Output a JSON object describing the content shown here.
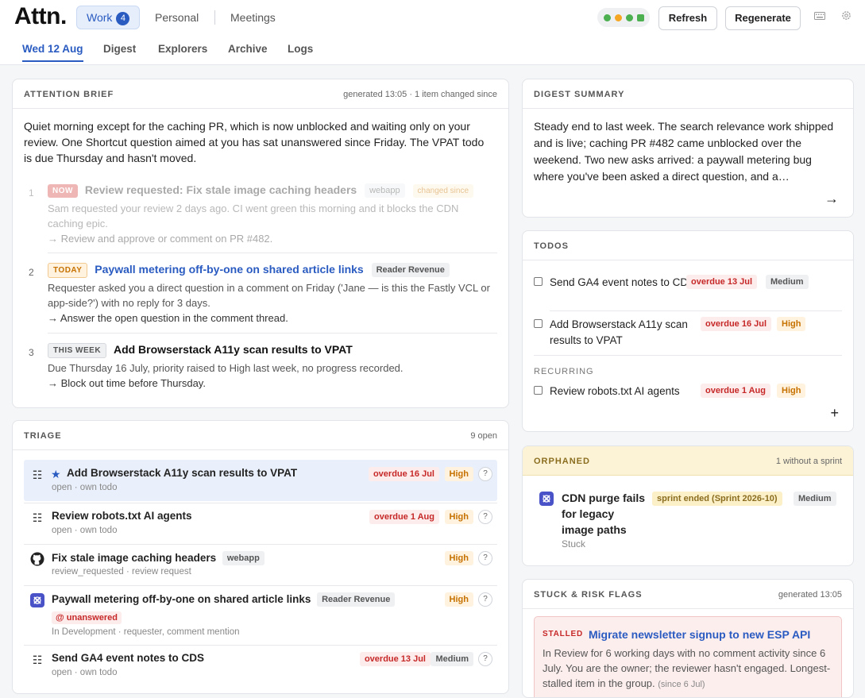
{
  "app": {
    "logo": "Attn."
  },
  "contexts": [
    {
      "label": "Work",
      "count": "4"
    },
    {
      "label": "Personal"
    },
    {
      "label": "Meetings"
    }
  ],
  "status_colors": [
    "#4caf50",
    "#f5a623",
    "#4caf50",
    "#4caf50"
  ],
  "toolbar": {
    "refresh": "Refresh",
    "regenerate": "Regenerate",
    "icons": [
      "keyboard-icon",
      "settings-icon"
    ]
  },
  "tabs": [
    "Wed 12 Aug",
    "Digest",
    "Explorers",
    "Archive",
    "Logs"
  ],
  "attention": {
    "title": "ATTENTION BRIEF",
    "meta": "generated 13:05 · 1 item changed since",
    "summary": "Quiet morning except for the caching PR, which is now unblocked and waiting only on your review. One Shortcut question aimed at you has sat unanswered since Friday. The VPAT todo is due Thursday and hasn't moved.",
    "items": [
      {
        "num": "1",
        "tag": "NOW",
        "title": "Review requested: Fix stale image caching headers",
        "chip": "webapp",
        "changed": "changed since",
        "desc": "Sam requested your review 2 days ago. CI went green this morning and it blocks the CDN caching epic.",
        "action": "Review and approve or comment on PR #482."
      },
      {
        "num": "2",
        "tag": "TODAY",
        "title": "Paywall metering off-by-one on shared article links",
        "chip": "Reader Revenue",
        "desc": "Requester asked you a direct question in a comment on Friday ('Jane — is this the Fastly VCL or app-side?') with no reply for 3 days.",
        "action": "Answer the open question in the comment thread."
      },
      {
        "num": "3",
        "tag": "THIS WEEK",
        "title": "Add Browserstack A11y scan results to VPAT",
        "desc": "Due Thursday 16 July, priority raised to High last week, no progress recorded.",
        "action": "Block out time before Thursday."
      }
    ]
  },
  "triage": {
    "title": "TRIAGE",
    "meta": "9 open",
    "rows": [
      {
        "title": "Add Browserstack A11y scan results to VPAT",
        "sub": "open · own todo",
        "due": "overdue 16 Jul",
        "priority": "High",
        "q": "?"
      },
      {
        "title": "Review robots.txt AI agents",
        "sub": "open · own todo",
        "due": "overdue 1 Aug",
        "priority": "High",
        "q": "?"
      },
      {
        "title": "Fix stale image caching headers",
        "chip": "webapp",
        "sub": "review_requested · review request",
        "priority": "High",
        "q": "?"
      },
      {
        "title": "Paywall metering off-by-one on shared article links",
        "chip": "Reader Revenue",
        "flag": "@ unanswered",
        "sub": "In Development · requester, comment mention",
        "priority": "High",
        "q": "?"
      },
      {
        "title": "Send GA4 event notes to CDS",
        "sub": "open · own todo",
        "due": "overdue 13 Jul",
        "priority": "Medium",
        "q": "?"
      }
    ]
  },
  "digest": {
    "title": "DIGEST SUMMARY",
    "text": "Steady end to last week. The search relevance work shipped and is live; caching PR #482 came unblocked over the weekend. Two new asks arrived: a paywall metering bug where you've been asked a direct question, and a…"
  },
  "todos": {
    "title": "TODOS",
    "items": [
      {
        "title": "Send GA4 event notes to CDS",
        "due": "overdue 13 Jul",
        "priority": "Medium"
      },
      {
        "title": "Add Browserstack A11y scan results to VPAT",
        "due": "overdue 16 Jul",
        "priority": "High"
      }
    ],
    "recurring_label": "RECURRING",
    "recurring": [
      {
        "title": "Review robots.txt AI agents",
        "due": "overdue 1 Aug",
        "priority": "High"
      }
    ],
    "add": "+"
  },
  "orphaned": {
    "title": "ORPHANED",
    "meta": "1 without a sprint",
    "item": {
      "title": "CDN purge fails for legacy image paths",
      "sprint": "sprint ended (Sprint 2026-10)",
      "priority": "Medium",
      "state": "Stuck"
    }
  },
  "stuck": {
    "title": "STUCK & RISK FLAGS",
    "meta": "generated 13:05",
    "item": {
      "tag": "STALLED",
      "title": "Migrate newsletter signup to new ESP API",
      "desc": "In Review for 6 working days with no comment activity since 6 July. You are the owner; the reviewer hasn't engaged.",
      "extra": "Longest-stalled item in the group.",
      "since": "(since 6 Jul)"
    }
  }
}
